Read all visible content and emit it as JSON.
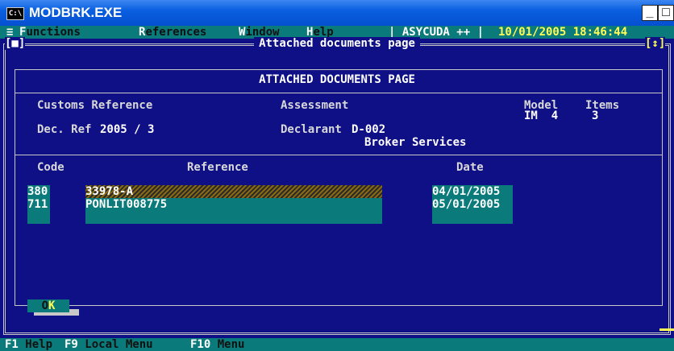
{
  "window": {
    "icon_text": "C:\\",
    "title": "MODBRK.EXE",
    "min": "_",
    "max": "□",
    "close": "✕"
  },
  "menu": {
    "system": "≡",
    "functions": {
      "key": "F",
      "rest": "unctions"
    },
    "references": {
      "key": "R",
      "rest": "eferences"
    },
    "window": {
      "key": "W",
      "rest": "indow"
    },
    "help": {
      "key": "H",
      "rest": "elp"
    },
    "app": "| ASYCUDA ++ |",
    "datetime": "10/01/2005 18:46:44"
  },
  "frame": {
    "title": "Attached documents page",
    "left_marker": "[■]",
    "right_marker": "[↕]"
  },
  "page": {
    "heading": "ATTACHED DOCUMENTS PAGE",
    "customs_reference_label": "Customs Reference",
    "assessment_label": "Assessment",
    "model_label": "Model",
    "items_label": "Items",
    "model_value": "IM  4",
    "items_value": "3",
    "dec_ref_label": "Dec. Ref",
    "dec_ref_value": "2005 / 3",
    "declarant_label": "Declarant",
    "declarant_code": "D-002",
    "declarant_name": "Broker Services"
  },
  "table": {
    "headers": {
      "code": "Code",
      "reference": "Reference",
      "date": "Date"
    },
    "rows": [
      {
        "code": "380",
        "reference": "33978-A",
        "date": "04/01/2005"
      },
      {
        "code": "711",
        "reference": "PONLIT008775",
        "date": "05/01/2005"
      }
    ]
  },
  "ok_button": {
    "key": "O",
    "rest": "K"
  },
  "status": {
    "f1": {
      "key": "F1",
      "label": " Help"
    },
    "f9": {
      "key": "F9",
      "label": " Local Menu"
    },
    "f10": {
      "key": "F10",
      "label": " Menu"
    }
  },
  "colors": {
    "console_bg": "#0f0f86",
    "cyan": "#0a7a7a",
    "highlight": "#ffff55",
    "titlebar": "#0a5fe0"
  }
}
